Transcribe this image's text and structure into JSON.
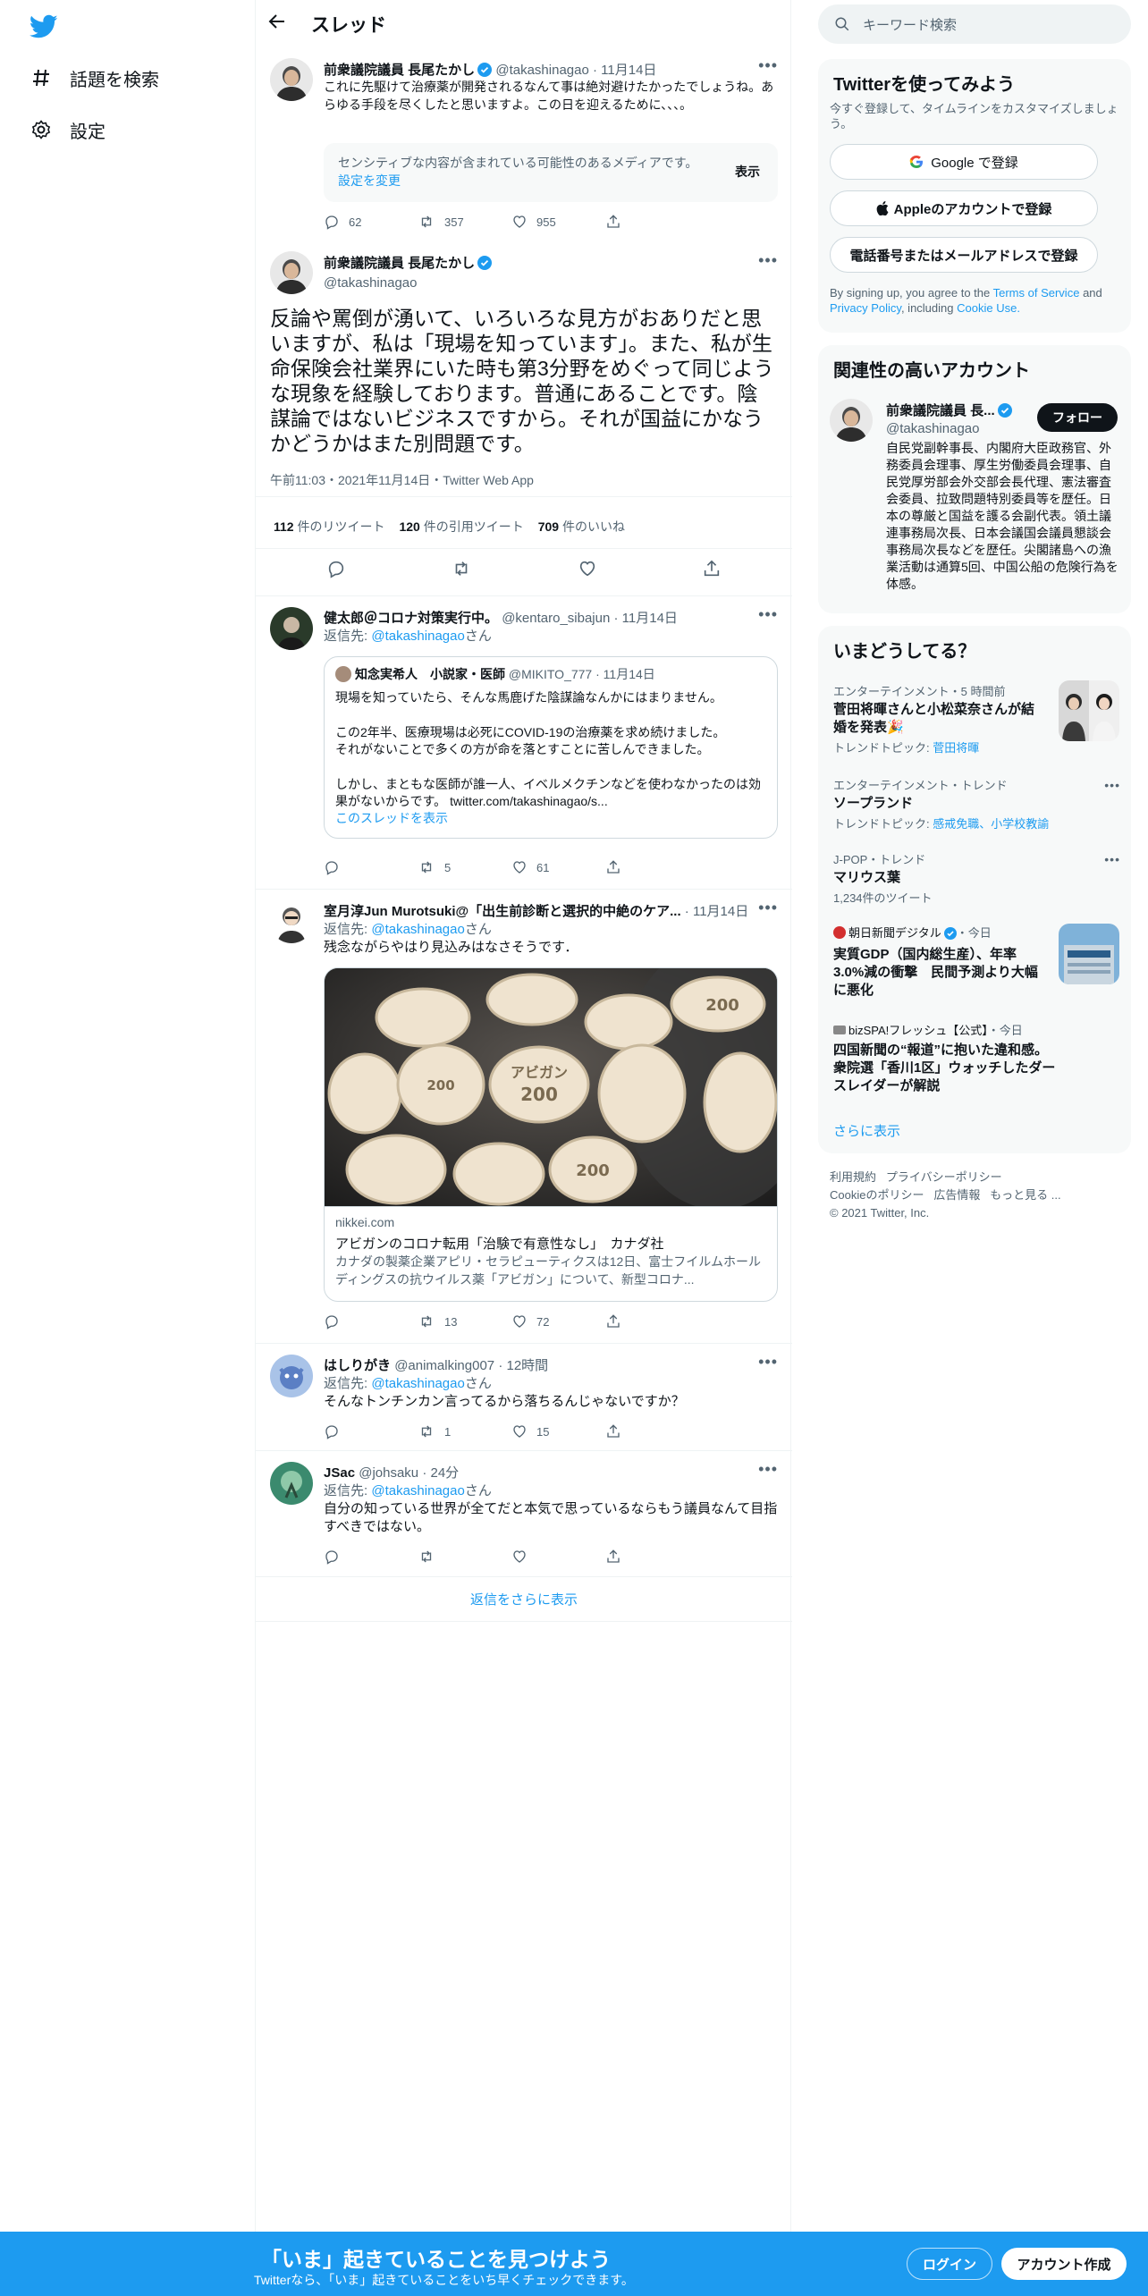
{
  "nav": {
    "explore_label": "話題を検索",
    "settings_label": "設定"
  },
  "header": {
    "title": "スレッド"
  },
  "thread": {
    "parent": {
      "name": "前衆議院議員 長尾たかし",
      "handle": "@takashinagao",
      "time": "11月14日",
      "text": "これに先駆けて治療薬が開発されるなんて事は絶対避けたかったでしょうね。あらゆる手段を尽くしたと思いますよ。この日を迎えるために、、、。",
      "sensitive_text": "センシティブな内容が含まれている可能性のあるメディアです。",
      "sensitive_link": "設定を変更",
      "sensitive_button": "表示",
      "replies": "62",
      "retweets": "357",
      "likes": "955"
    },
    "main": {
      "name": "前衆議院議員 長尾たかし",
      "handle": "@takashinagao",
      "text": "反論や罵倒が湧いて、いろいろな見方がおありだと思いますが、私は「現場を知っています」。また、私が生命保険会社業界にいた時も第3分野をめぐって同じような現象を経験しております。普通にあることです。陰謀論ではないビジネスですから。それが国益にかなうかどうかはまた別問題です。",
      "meta": "午前11:03・2021年11月14日・Twitter Web App",
      "retweets_count": "112",
      "retweets_label": "件のリツイート",
      "quotes_count": "120",
      "quotes_label": "件の引用ツイート",
      "likes_count": "709",
      "likes_label": "件のいいね"
    },
    "replies": [
      {
        "name": "健太郎＠コロナ対策実行中。",
        "handle": "@kentaro_sibajun",
        "time": "11月14日",
        "reply_prefix": "返信先:",
        "reply_to": "@takashinagao",
        "reply_suffix": "さん",
        "quote": {
          "name": "知念実希人　小説家・医師",
          "handle": "@MIKITO_777",
          "time": "11月14日",
          "line1": "現場を知っていたら、そんな馬鹿げた陰謀論なんかにはまりません。",
          "line2": "この2年半、医療現場は必死にCOVID-19の治療薬を求め続けました。",
          "line3": "それがないことで多くの方が命を落とすことに苦しんできました。",
          "line4": "しかし、まともな医師が誰一人、イベルメクチンなどを使わなかったのは効果がないからです。 twitter.com/takashinagao/s...",
          "show_thread": "このスレッドを表示"
        },
        "replies": "",
        "retweets": "5",
        "likes": "61"
      },
      {
        "name": "室月淳Jun Murotsuki@「出生前診断と選択的中絶のケア...",
        "time": "11月14日",
        "reply_prefix": "返信先:",
        "reply_to": "@takashinagao",
        "reply_suffix": "さん",
        "text": "残念ながらやはり見込みはなさそうです．",
        "card": {
          "domain": "nikkei.com",
          "title": "アビガンのコロナ転用「治験で有意性なし」　カナダ社",
          "desc": "カナダの製薬企業アピリ・セラピューティクスは12日、富士フイルムホールディングスの抗ウイルス薬「アビガン」について、新型コロナ...",
          "pill_text_1": "アビガン",
          "pill_text_2": "200"
        },
        "replies": "",
        "retweets": "13",
        "likes": "72"
      },
      {
        "name": "はしりがき",
        "handle": "@animalking007",
        "time": "12時間",
        "reply_prefix": "返信先:",
        "reply_to": "@takashinagao",
        "reply_suffix": "さん",
        "text": "そんなトンチンカン言ってるから落ちるんじゃないですか？",
        "replies": "",
        "retweets": "1",
        "likes": "15"
      },
      {
        "name": "JSac",
        "handle": "@johsaku",
        "time": "24分",
        "reply_prefix": "返信先:",
        "reply_to": "@takashinagao",
        "reply_suffix": "さん",
        "text": "自分の知っている世界が全てだと本気で思っているならもう議員なんて目指すべきではない。",
        "replies": "",
        "retweets": "",
        "likes": ""
      }
    ],
    "show_more": "返信をさらに表示"
  },
  "sidebar": {
    "search_placeholder": "キーワード検索",
    "signup": {
      "title": "Twitterを使ってみよう",
      "subtitle": "今すぐ登録して、タイムラインをカスタマイズしましょう。",
      "google_button": "Google で登録",
      "apple_button": "Appleのアカウントで登録",
      "phone_button": "電話番号またはメールアドレスで登録",
      "terms_prefix": "By signing up, you agree to the",
      "terms_link": "Terms of Service",
      "terms_and": "and",
      "privacy_link": "Privacy Policy",
      "terms_including": ", including",
      "cookie_link": "Cookie Use."
    },
    "related": {
      "title": "関連性の高いアカウント",
      "name": "前衆議院議員 長...",
      "handle": "@takashinagao",
      "follow_button": "フォロー",
      "bio": "自民党副幹事長、内閣府大臣政務官、外務委員会理事、厚生労働委員会理事、自民党厚労部会外交部会長代理、憲法審査会委員、拉致問題特別委員等を歴任。日本の尊厳と国益を護る会副代表。領土議連事務局次長、日本会議国会議員懇談会事務局次長などを歴任。尖閣諸島への漁業活動は通算5回、中国公船の危険行為を体感。"
    },
    "trends": {
      "title": "いまどうしてる？",
      "items": [
        {
          "category": "エンターテインメント・5 時間前",
          "name": "菅田将暉さんと小松菜奈さんが結婚を発表🎉",
          "sub_prefix": "トレンドトピック:",
          "sub_link": "菅田将暉"
        },
        {
          "category": "エンターテインメント・トレンド",
          "name": "ソープランド",
          "sub_prefix": "トレンドトピック:",
          "sub_link": "感戒免職、小学校教諭"
        },
        {
          "category": "J-POP・トレンド",
          "name": "マリウス葉",
          "sub": "1,234件のツイート"
        },
        {
          "category_source": "朝日新聞デジタル",
          "category_time": "・今日",
          "name": "実質GDP（国内総生産）、年率3.0%減の衝撃　民間予測より大幅に悪化"
        },
        {
          "category_source": "bizSPA!フレッシュ【公式】",
          "category_time": "・今日",
          "name": "四国新聞の“報道”に抱いた違和感。衆院選「香川1区」ウォッチしたダースレイダーが解説"
        }
      ],
      "show_more": "さらに表示"
    },
    "footer": {
      "line1": [
        "利用規約",
        "プライバシーポリシー"
      ],
      "line2": [
        "Cookieのポリシー",
        "広告情報",
        "もっと見る ..."
      ],
      "copyright": "© 2021 Twitter, Inc."
    }
  },
  "bottom_bar": {
    "title": "「いま」起きていることを見つけよう",
    "subtitle": "Twitterなら、「いま」起きていることをいち早くチェックできます。",
    "login_button": "ログイン",
    "signup_button": "アカウント作成"
  },
  "colors": {
    "brand": "#1d9bf0",
    "text": "#0f1419",
    "muted": "#536471"
  }
}
